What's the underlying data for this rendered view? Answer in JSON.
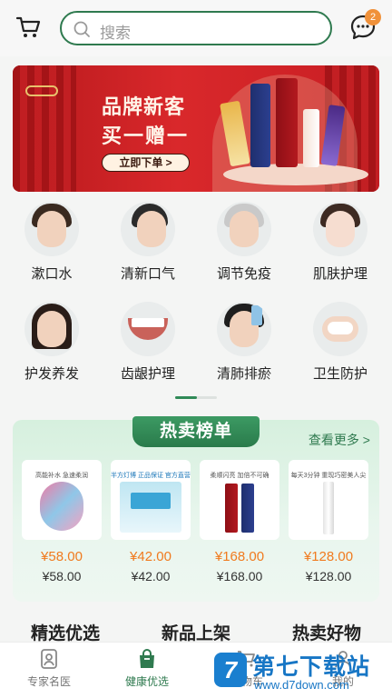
{
  "header": {
    "search_placeholder": "搜索",
    "message_badge": "2",
    "cart_icon": "cart-icon",
    "message_icon": "chat-bubble-icon"
  },
  "banner": {
    "headline": "品牌新客",
    "subline": "买一赠一",
    "cta": "立即下单 >"
  },
  "categories": [
    {
      "label": "漱口水",
      "icon": "woman-rinsing"
    },
    {
      "label": "清新口气",
      "icon": "man-breath"
    },
    {
      "label": "调节免疫",
      "icon": "old-man"
    },
    {
      "label": "肌肤护理",
      "icon": "woman-skin"
    },
    {
      "label": "护发养发",
      "icon": "woman-hair"
    },
    {
      "label": "齿龈护理",
      "icon": "teeth-smile"
    },
    {
      "label": "清肺排瘀",
      "icon": "man-drinking"
    },
    {
      "label": "卫生防护",
      "icon": "hands-washing"
    }
  ],
  "hot_list": {
    "title": "热卖榜单",
    "more": "查看更多 >",
    "products": [
      {
        "tag": "高能补水 急速柔润",
        "price": "¥58.00",
        "original": "¥58.00"
      },
      {
        "tag": "半方灯博 正品保证 官方直营",
        "price": "¥42.00",
        "original": "¥42.00"
      },
      {
        "tag": "柔顺闪亮 加倍不可确",
        "price": "¥168.00",
        "original": "¥168.00"
      },
      {
        "tag": "每天3分钟 重现巧密美人尖",
        "price": "¥128.00",
        "original": "¥128.00"
      }
    ]
  },
  "sections": [
    "精选优选",
    "新品上架",
    "热卖好物"
  ],
  "nav": [
    {
      "label": "专家名医",
      "icon": "doctor-icon",
      "active": false
    },
    {
      "label": "健康优选",
      "icon": "shopping-bag-icon",
      "active": true
    },
    {
      "label": "购物车",
      "icon": "cart-icon",
      "active": false
    },
    {
      "label": "我的",
      "icon": "person-icon",
      "active": false
    }
  ],
  "watermark": {
    "name": "第七下载站",
    "url": "www.d7down.com",
    "logo": "7"
  },
  "colors": {
    "brand": "#2f7a4f",
    "price": "#f07a1e",
    "badge": "#f0913a",
    "banner": "#c81e23"
  }
}
